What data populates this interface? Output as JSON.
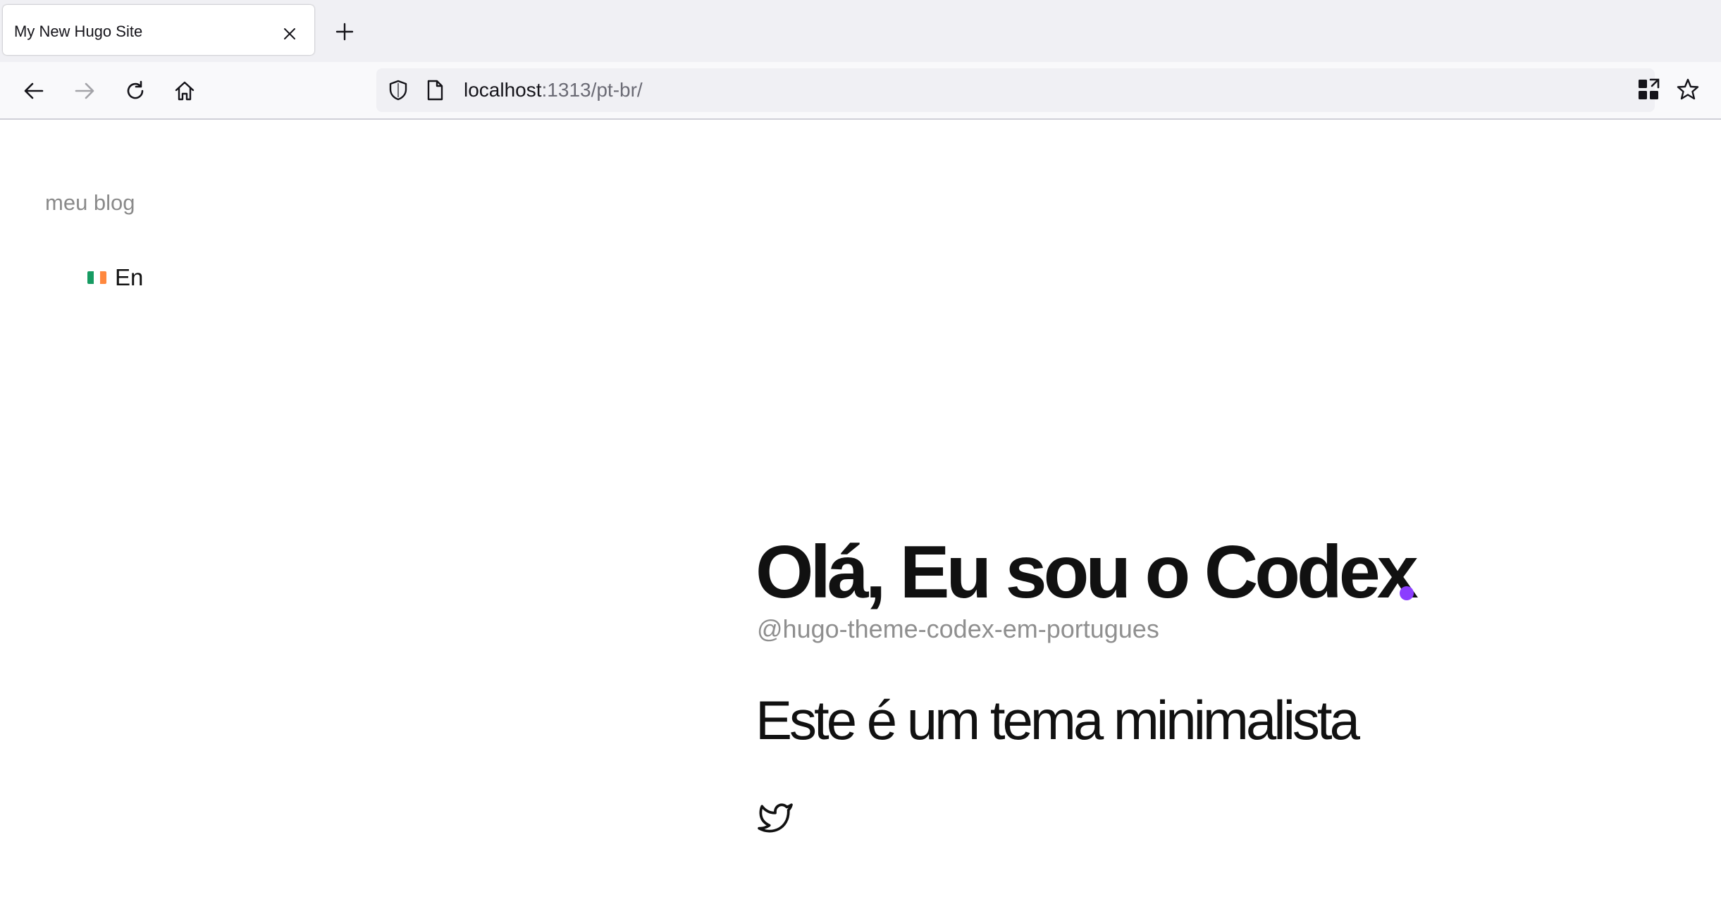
{
  "browser": {
    "tab": {
      "title": "My New Hugo Site"
    },
    "url": {
      "host": "localhost",
      "rest": ":1313/pt-br/"
    }
  },
  "site": {
    "title": "meu blog",
    "language_link": {
      "label": "En",
      "flag_colors": [
        "#169b62",
        "#ffffff",
        "#ff883e"
      ]
    },
    "accent_color": "#8b3dff"
  },
  "hero": {
    "title": "Olá, Eu sou o Codex",
    "handle": "@hugo-theme-codex-em-portugues",
    "tagline": "Este é um tema minimalista"
  },
  "social": {
    "icons": [
      "twitter-icon"
    ]
  }
}
